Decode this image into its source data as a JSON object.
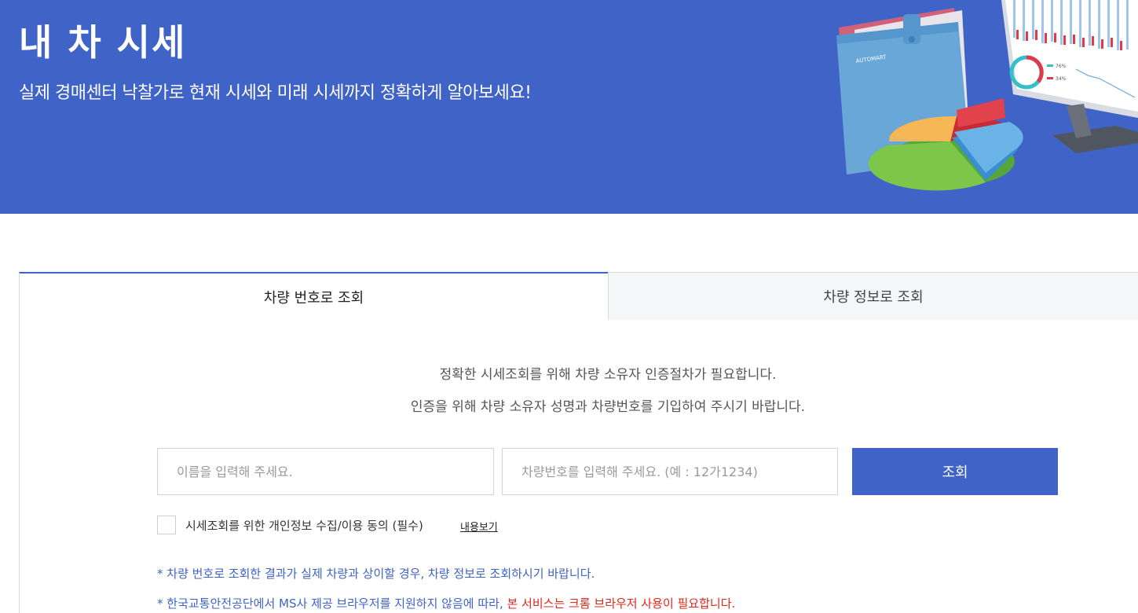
{
  "hero": {
    "title": "내 차 시세",
    "subtitle": "실제 경매센터 낙찰가로 현재 시세와 미래 시세까지 정확하게 알아보세요!",
    "art_labels": {
      "pct_a": "76%",
      "pct_b": "34%"
    }
  },
  "tabs": [
    {
      "label": "차량 번호로 조회",
      "active": true
    },
    {
      "label": "차량 정보로 조회",
      "active": false
    }
  ],
  "notice": {
    "line1": "정확한 시세조회를 위해 차량 소유자 인증절차가 필요합니다.",
    "line2": "인증을 위해 차량 소유자 성명과 차량번호를 기입하여 주시기 바랍니다."
  },
  "form": {
    "name_placeholder": "이름을 입력해 주세요.",
    "name_value": "",
    "plate_placeholder": "차량번호를 입력해 주세요. (예 : 12가1234)",
    "plate_value": "",
    "submit_label": "조회"
  },
  "agreement": {
    "label": "시세조회를 위한 개인정보 수집/이용 동의 (필수)",
    "link": "내용보기",
    "checked": false
  },
  "notes": {
    "note1": "* 차량 번호로 조회한 결과가 실제 차량과 상이할 경우, 차량 정보로 조회하시기 바랍니다.",
    "note2_prefix": "* 한국교통안전공단에서 MS사 제공 브라우저를 지원하지 않음에 따라, ",
    "note2_highlight": "본 서비스는 크롬 브라우저 사용이 필요합니다."
  },
  "colors": {
    "brand_blue": "#3f63c6",
    "warning_red": "#e0261c",
    "tab_inactive_bg": "#f5f6f7"
  }
}
